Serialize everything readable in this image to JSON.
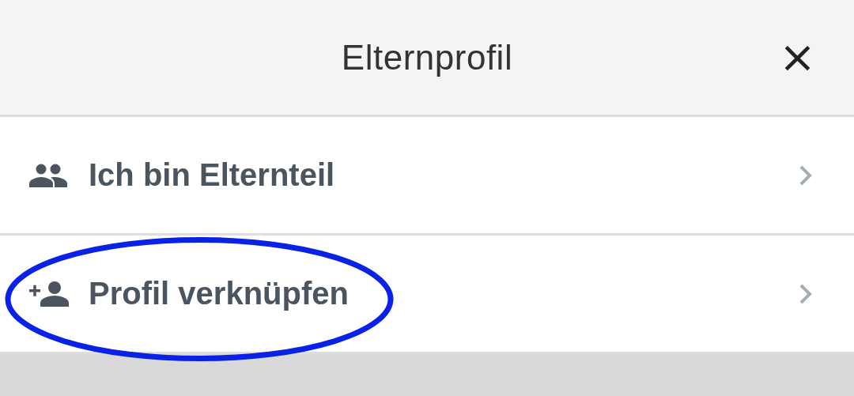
{
  "header": {
    "title": "Elternprofil",
    "close": "×"
  },
  "items": [
    {
      "kind": "group",
      "label": "Ich bin Elternteil",
      "highlighted": false
    },
    {
      "kind": "add-person",
      "label": "Profil verknüpfen",
      "highlighted": true
    }
  ]
}
